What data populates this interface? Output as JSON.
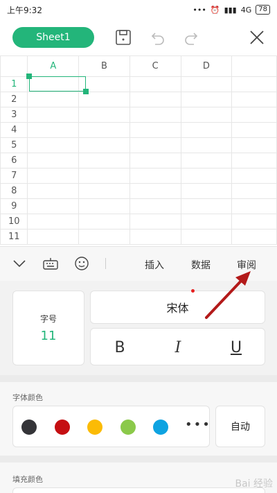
{
  "status": {
    "time": "上午9:32",
    "signal_text": "4G",
    "battery": "78"
  },
  "toolbar": {
    "sheet_name": "Sheet1"
  },
  "grid": {
    "columns": [
      "A",
      "B",
      "C",
      "D"
    ],
    "rows": [
      "1",
      "2",
      "3",
      "4",
      "5",
      "6",
      "7",
      "8",
      "9",
      "10",
      "11"
    ]
  },
  "tabs": {
    "insert": "插入",
    "data": "数据",
    "review": "审阅"
  },
  "format": {
    "font_size_label": "字号",
    "font_size_value": "11",
    "font_name": "宋体",
    "bold": "B",
    "italic": "I",
    "underline": "U"
  },
  "font_color": {
    "label": "字体颜色",
    "swatches": [
      "#343438",
      "#c50f12",
      "#fbbb05",
      "#8bc94a",
      "#0ea3e1"
    ],
    "auto_label": "自动"
  },
  "fill_color": {
    "label": "填充颜色"
  },
  "annotation": {
    "arrow_color": "#b31a1a"
  },
  "watermark": "Bai 经验"
}
